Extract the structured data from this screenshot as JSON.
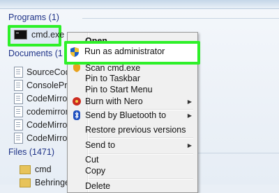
{
  "groups": {
    "programs": "Programs (1)",
    "documents": "Documents (1",
    "files": "Files (1471)"
  },
  "cmd_label": "cmd.exe",
  "documents": [
    "SourceCode",
    "ConsolePro",
    "CodeMirror",
    "codemirror",
    "CodeMirror",
    "CodeMirror"
  ],
  "files": [
    "cmd",
    "Behringer C"
  ],
  "menu": {
    "open": "Open",
    "run_as_admin": "Run as administrator",
    "scan": "Scan cmd.exe",
    "pin_taskbar": "Pin to Taskbar",
    "pin_start": "Pin to Start Menu",
    "burn": "Burn with Nero",
    "bluetooth": "Send by Bluetooth to",
    "restore": "Restore previous versions",
    "send_to": "Send to",
    "cut": "Cut",
    "copy": "Copy",
    "delete": "Delete"
  },
  "colors": {
    "highlight": "#2ef029",
    "group_title": "#1e3287"
  }
}
